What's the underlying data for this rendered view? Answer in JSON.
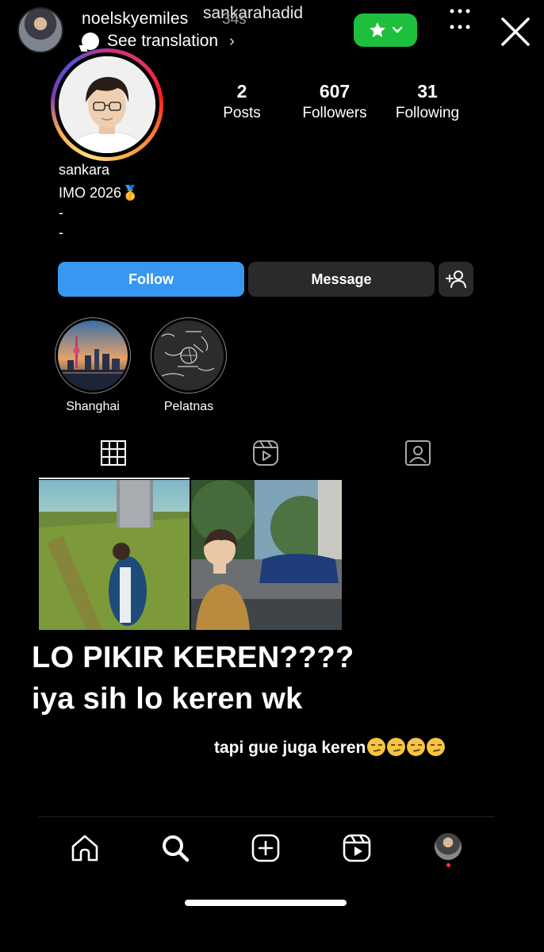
{
  "story": {
    "username": "noelskyemiles",
    "time": "34s",
    "mention": "sankarahadid",
    "translation": "See translation",
    "chevron": "›"
  },
  "profile": {
    "stats": [
      {
        "num": "2",
        "label": "Posts"
      },
      {
        "num": "607",
        "label": "Followers"
      },
      {
        "num": "31",
        "label": "Following"
      }
    ],
    "name": "sankara",
    "bio": [
      "IMO 2026🥇",
      "-",
      "-"
    ]
  },
  "actions": {
    "follow": "Follow",
    "message": "Message"
  },
  "highlights": [
    {
      "label": "Shanghai"
    },
    {
      "label": "Pelatnas"
    }
  ],
  "caption": {
    "line1": "LO PIKIR KEREN????",
    "line2": "iya sih lo keren wk",
    "line3": "tapi gue juga keren"
  },
  "colors": {
    "follow_button": "#3897f0",
    "close_friends_badge": "#1dbf3c",
    "secondary_button": "#2a2a2a"
  },
  "icons": [
    "close-icon",
    "star-icon",
    "more-icon",
    "add-person-icon",
    "grid-icon",
    "reels-icon",
    "tagged-icon",
    "home-icon",
    "search-icon",
    "create-icon",
    "reels-nav-icon"
  ]
}
